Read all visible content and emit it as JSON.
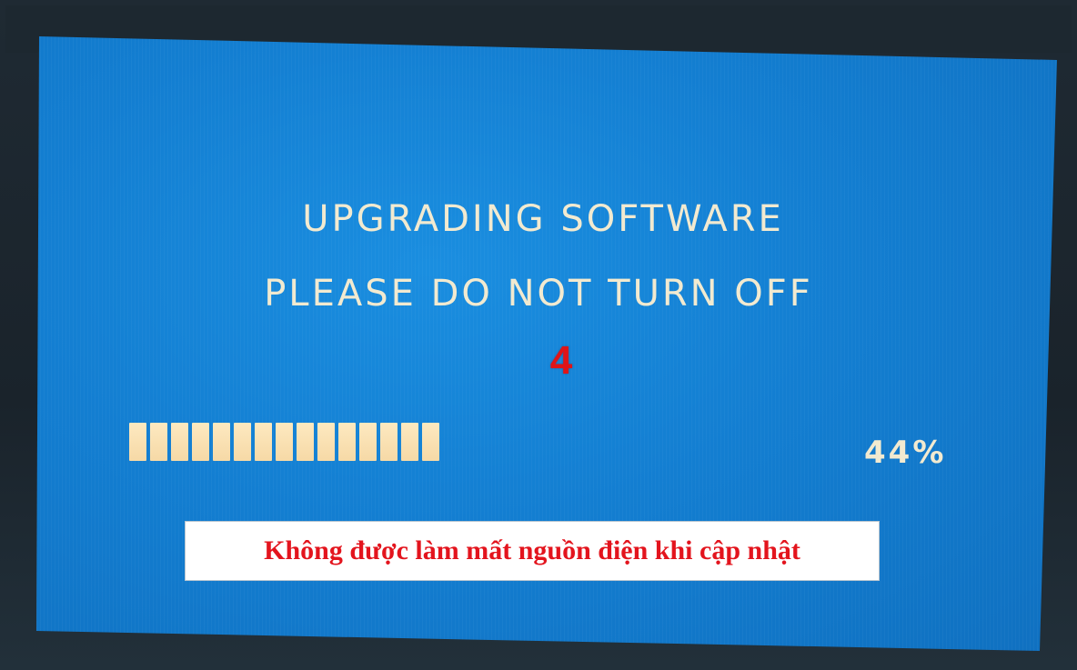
{
  "screen": {
    "title_line1": "UPGRADING SOFTWARE",
    "title_line2": "PLEASE DO NOT TURN OFF",
    "countdown": "4",
    "progress_percent_label": "44%",
    "progress_fraction": 0.44
  },
  "caption": {
    "text": "Không được làm mất nguồn điện khi cập nhật"
  },
  "colors": {
    "screen_bg": "#137ed1",
    "osd_text": "#f2ead0",
    "progress_segment": "#f6d9a6",
    "countdown": "#e01418",
    "caption_text": "#e3141d"
  }
}
